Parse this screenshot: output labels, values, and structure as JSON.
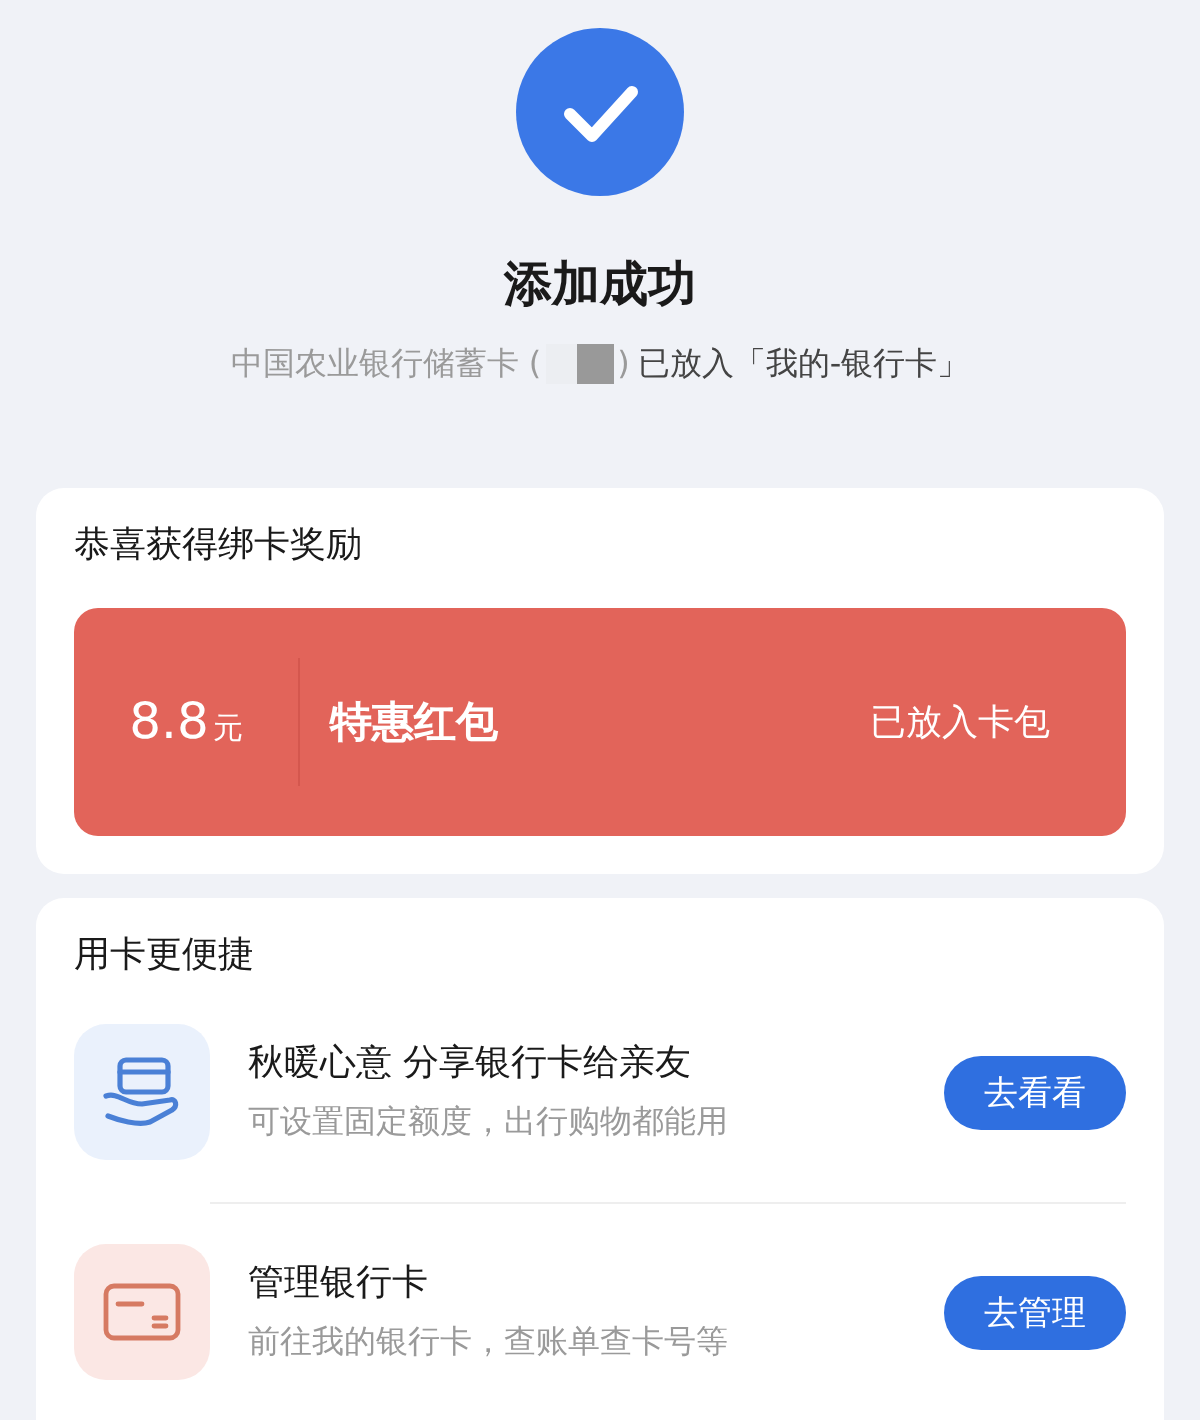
{
  "status": {
    "title": "添加成功",
    "card_name": "中国农业银行储蓄卡 (",
    "card_close": ")",
    "placed_text": "已放入「我的-银行卡」"
  },
  "reward": {
    "heading": "恭喜获得绑卡奖励",
    "amount": "8.8",
    "unit": "元",
    "name": "特惠红包",
    "state": "已放入卡包"
  },
  "shortcuts": {
    "heading": "用卡更便捷",
    "items": [
      {
        "kind": "share",
        "title": "秋暖心意 分享银行卡给亲友",
        "subtitle": "可设置固定额度，出行购物都能用",
        "button": "去看看"
      },
      {
        "kind": "manage",
        "title": "管理银行卡",
        "subtitle": "前往我的银行卡，查账单查卡号等",
        "button": "去管理"
      }
    ]
  }
}
